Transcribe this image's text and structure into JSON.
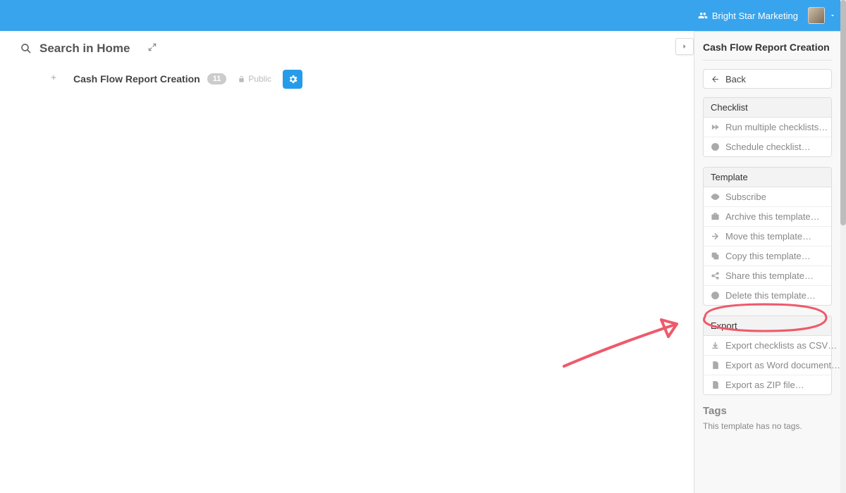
{
  "topbar": {
    "org_name": "Bright Star Marketing"
  },
  "search": {
    "label": "Search in Home"
  },
  "header": {
    "title": "Cash Flow Report Creation",
    "count": "11",
    "visibility": "Public"
  },
  "panel": {
    "title": "Cash Flow Report Creation",
    "back": "Back",
    "sections": {
      "checklist": {
        "header": "Checklist",
        "run": "Run multiple checklists…",
        "schedule": "Schedule checklist…"
      },
      "template": {
        "header": "Template",
        "subscribe": "Subscribe",
        "archive": "Archive this template…",
        "move": "Move this template…",
        "copy": "Copy this template…",
        "share": "Share this template…",
        "delete": "Delete this template…"
      },
      "export": {
        "header": "Export",
        "csv": "Export checklists as CSV…",
        "word": "Export as Word document…",
        "zip": "Export as ZIP file…"
      }
    },
    "tags": {
      "header": "Tags",
      "empty": "This template has no tags."
    }
  }
}
